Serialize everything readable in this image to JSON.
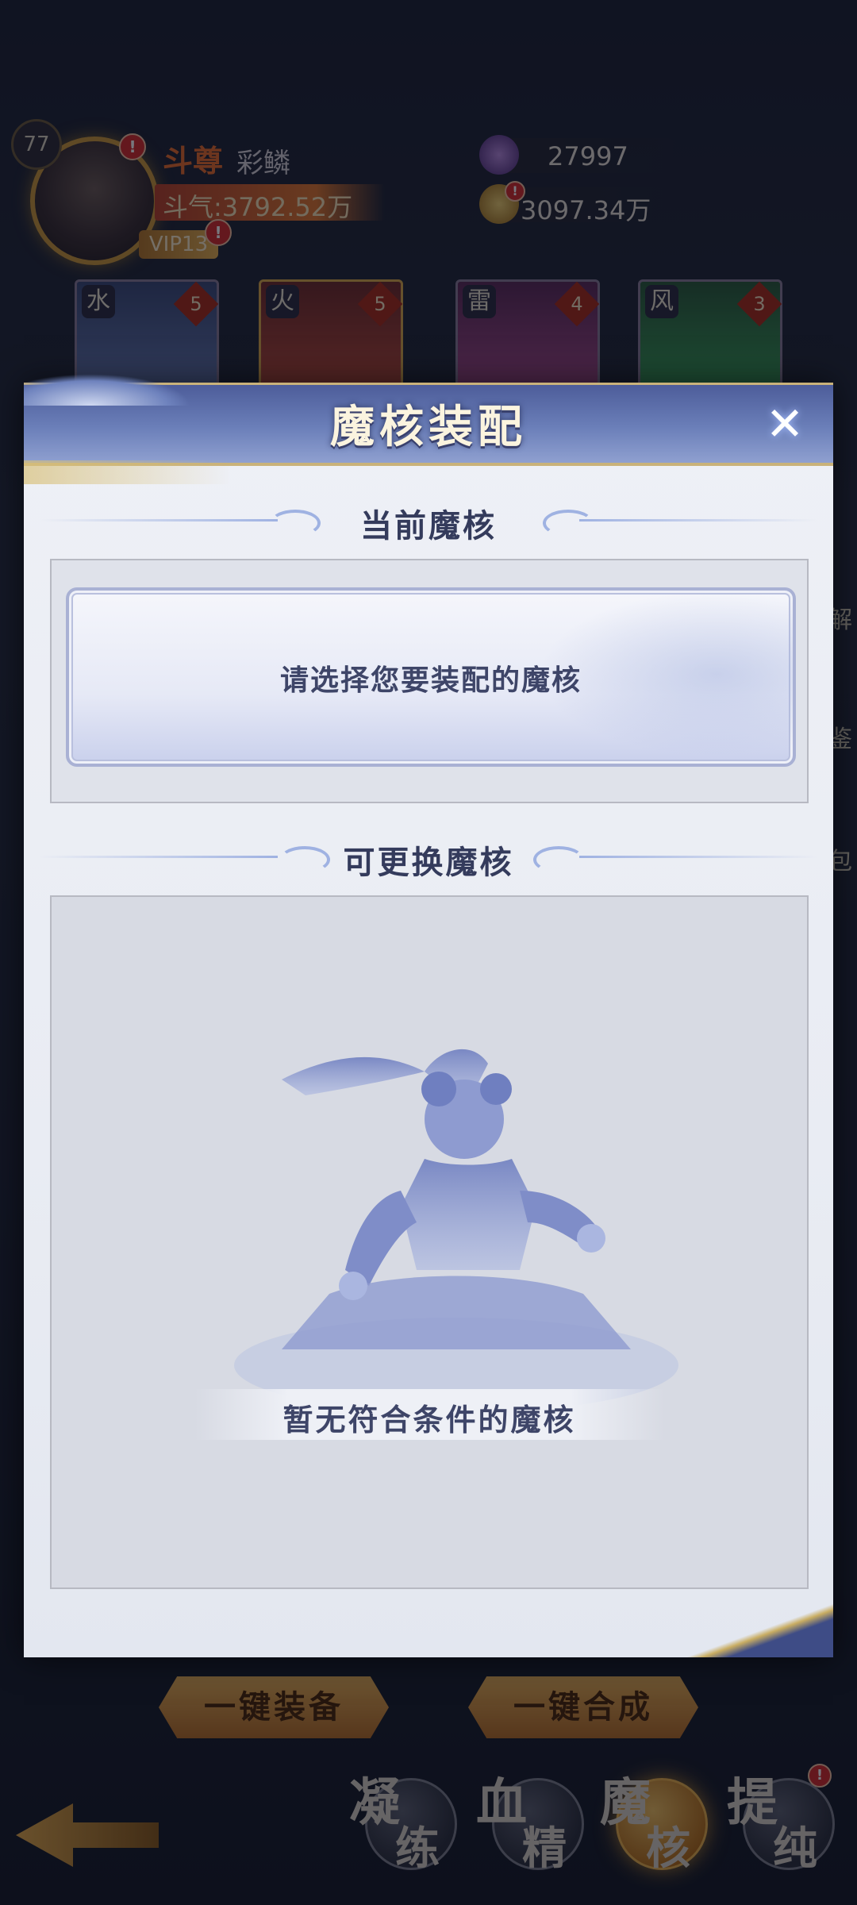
{
  "player": {
    "level": "77",
    "rank": "斗尊",
    "name": "彩鳞",
    "power": "斗气:3792.52万",
    "vip": "VIP13",
    "alert": "!"
  },
  "resources": {
    "gems": "27997",
    "gold": "3097.34万"
  },
  "elements": [
    {
      "char": "水",
      "count": "5"
    },
    {
      "char": "火",
      "count": "5"
    },
    {
      "char": "雷",
      "count": "4"
    },
    {
      "char": "风",
      "count": "3"
    }
  ],
  "side_labels": [
    "解",
    "鉴",
    "包"
  ],
  "bottom": {
    "equip_all": "一键装备",
    "synth_all": "一键合成",
    "tabs": [
      {
        "c1": "凝",
        "c2": "练"
      },
      {
        "c1": "血",
        "c2": "精"
      },
      {
        "c1": "魔",
        "c2": "核"
      },
      {
        "c1": "提",
        "c2": "纯"
      }
    ]
  },
  "modal": {
    "title": "魔核装配",
    "current_section": "当前魔核",
    "current_placeholder": "请选择您要装配的魔核",
    "replace_section": "可更换魔核",
    "empty_text": "暂无符合条件的魔核"
  },
  "colors": {
    "header": "#6b7fb9",
    "accent_gold": "#c9b27a",
    "text_dark": "#3e4568"
  }
}
